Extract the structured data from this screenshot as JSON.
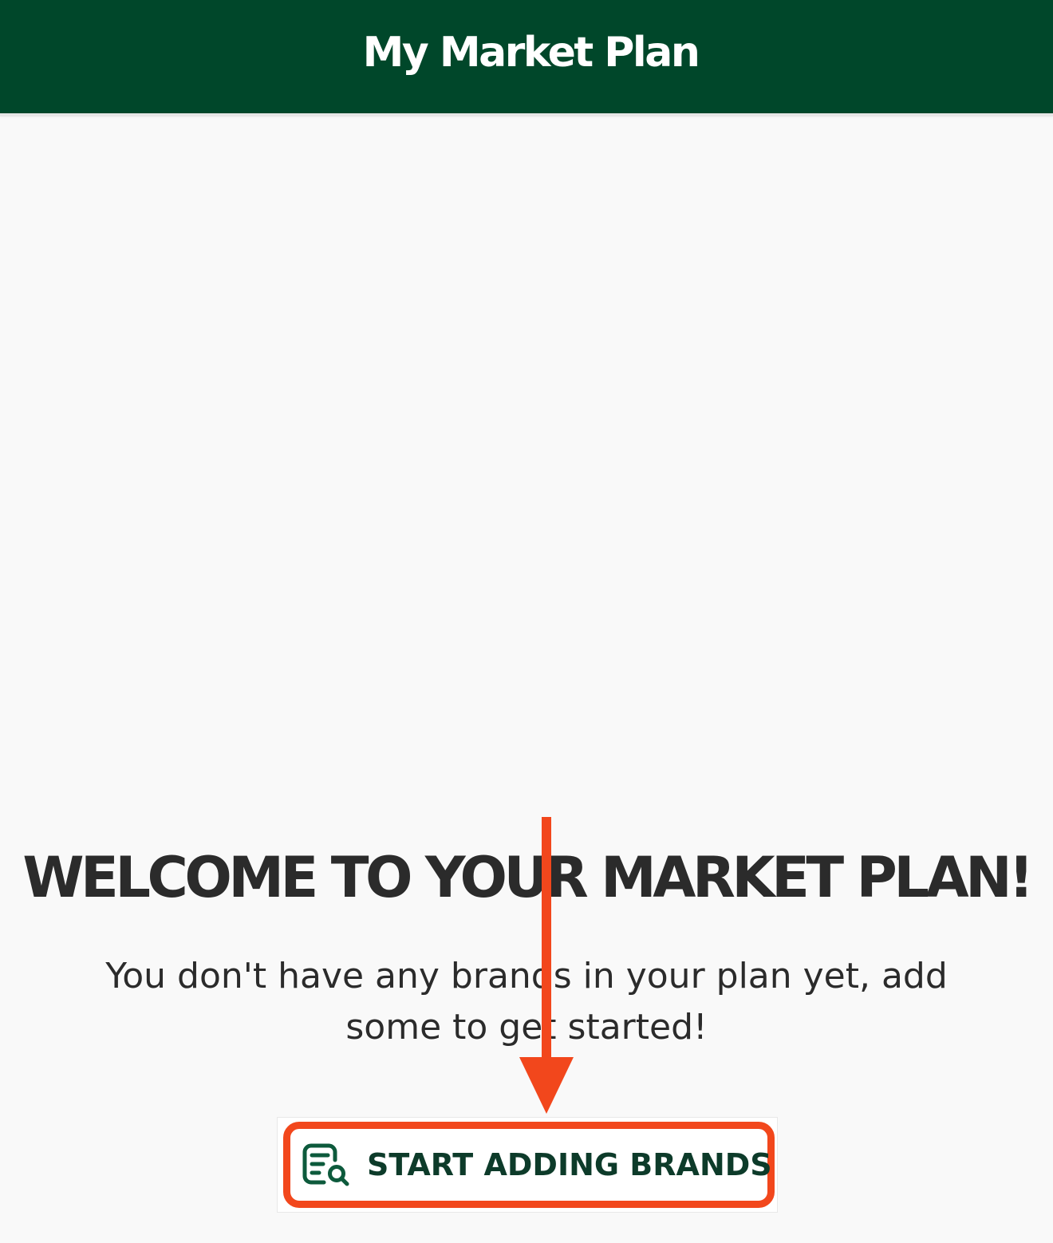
{
  "header": {
    "title": "My Market Plan",
    "background_color": "#00472a"
  },
  "main": {
    "heading": "WELCOME TO YOUR MARKET PLAN!",
    "subtext": "You don't have any brands in your plan yet, add some to get started!",
    "start_button": {
      "label": "START ADDING BRANDS",
      "icon": "list-search-icon"
    }
  },
  "annotation": {
    "color": "#f2471c",
    "type": "arrow-and-highlight"
  }
}
